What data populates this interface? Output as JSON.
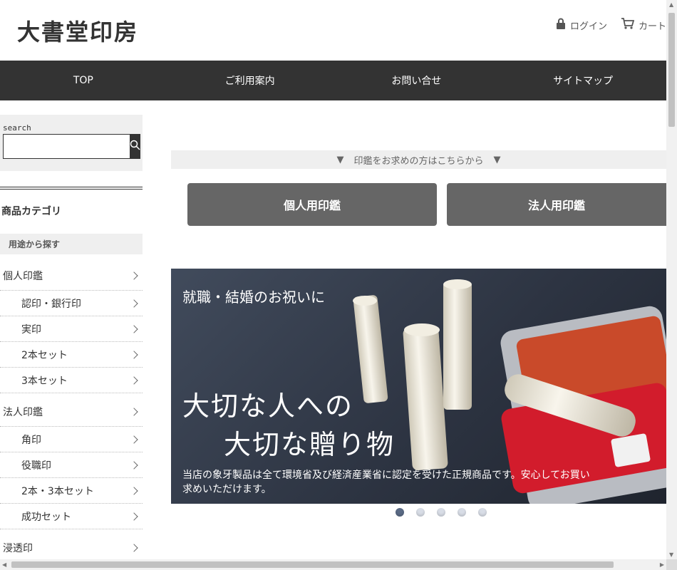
{
  "header": {
    "logo": "大書堂印房",
    "login_label": "ログイン",
    "cart_label": "カート"
  },
  "nav": {
    "items": [
      "TOP",
      "ご利用案内",
      "お問い合せ",
      "サイトマップ"
    ]
  },
  "sidebar": {
    "search_label": "search",
    "search_placeholder": "",
    "category_title": "商品カテゴリ",
    "subhead": "用途から探す",
    "items": [
      {
        "label": "個人印鑑",
        "level": "top"
      },
      {
        "label": "認印・銀行印",
        "level": "sub"
      },
      {
        "label": "実印",
        "level": "sub"
      },
      {
        "label": "2本セット",
        "level": "sub"
      },
      {
        "label": "3本セット",
        "level": "sub"
      },
      {
        "label": "法人印鑑",
        "level": "top"
      },
      {
        "label": "角印",
        "level": "sub"
      },
      {
        "label": "役職印",
        "level": "sub"
      },
      {
        "label": "2本・3本セット",
        "level": "sub"
      },
      {
        "label": "成功セット",
        "level": "sub"
      },
      {
        "label": "浸透印",
        "level": "top"
      }
    ]
  },
  "main": {
    "band_text": "印鑑をお求めの方はこちらから",
    "band_arrow": "▼",
    "btn_personal": "個人用印鑑",
    "btn_corporate": "法人用印鑑",
    "banner": {
      "line1": "就職・結婚のお祝いに",
      "line2": "大切な人への",
      "line3": "大切な贈り物",
      "line4": "当店の象牙製品は全て環境省及び経済産業省に認定を受けた正規商品です。安心してお買い求めいただけます。"
    },
    "slide_count": 5,
    "active_slide": 1
  },
  "colors": {
    "nav_bg": "#333333",
    "button_bg": "#666666",
    "band_bg": "#efefef"
  }
}
